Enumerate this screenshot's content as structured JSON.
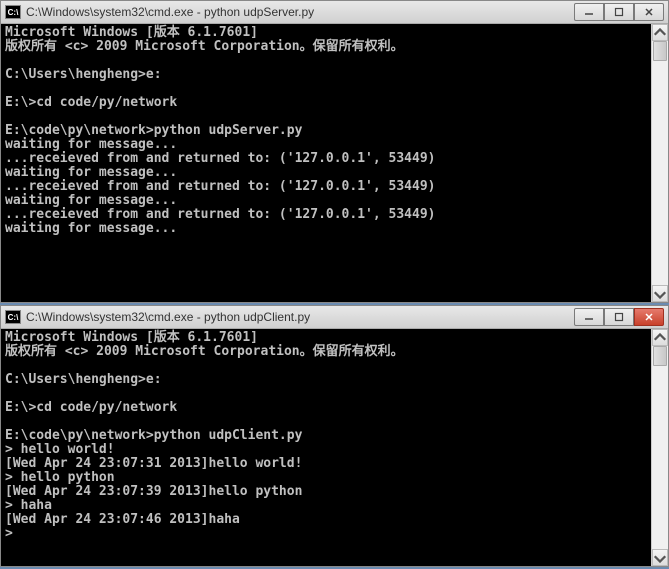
{
  "window1": {
    "title": "C:\\Windows\\system32\\cmd.exe - python  udpServer.py",
    "icon_label": "C:\\",
    "lines": [
      "Microsoft Windows [版本 6.1.7601]",
      "版权所有 <c> 2009 Microsoft Corporation。保留所有权利。",
      "",
      "C:\\Users\\hengheng>e:",
      "",
      "E:\\>cd code/py/network",
      "",
      "E:\\code\\py\\network>python udpServer.py",
      "waiting for message...",
      "...receieved from and returned to: ('127.0.0.1', 53449)",
      "waiting for message...",
      "...receieved from and returned to: ('127.0.0.1', 53449)",
      "waiting for message...",
      "...receieved from and returned to: ('127.0.0.1', 53449)",
      "waiting for message..."
    ]
  },
  "window2": {
    "title": "C:\\Windows\\system32\\cmd.exe - python  udpClient.py",
    "icon_label": "C:\\",
    "lines": [
      "Microsoft Windows [版本 6.1.7601]",
      "版权所有 <c> 2009 Microsoft Corporation。保留所有权利。",
      "",
      "C:\\Users\\hengheng>e:",
      "",
      "E:\\>cd code/py/network",
      "",
      "E:\\code\\py\\network>python udpClient.py",
      "> hello world!",
      "[Wed Apr 24 23:07:31 2013]hello world!",
      "> hello python",
      "[Wed Apr 24 23:07:39 2013]hello python",
      "> haha",
      "[Wed Apr 24 23:07:46 2013]haha",
      ">"
    ]
  },
  "controls": {
    "minimize": "─",
    "maximize": "□",
    "close": "✕"
  }
}
